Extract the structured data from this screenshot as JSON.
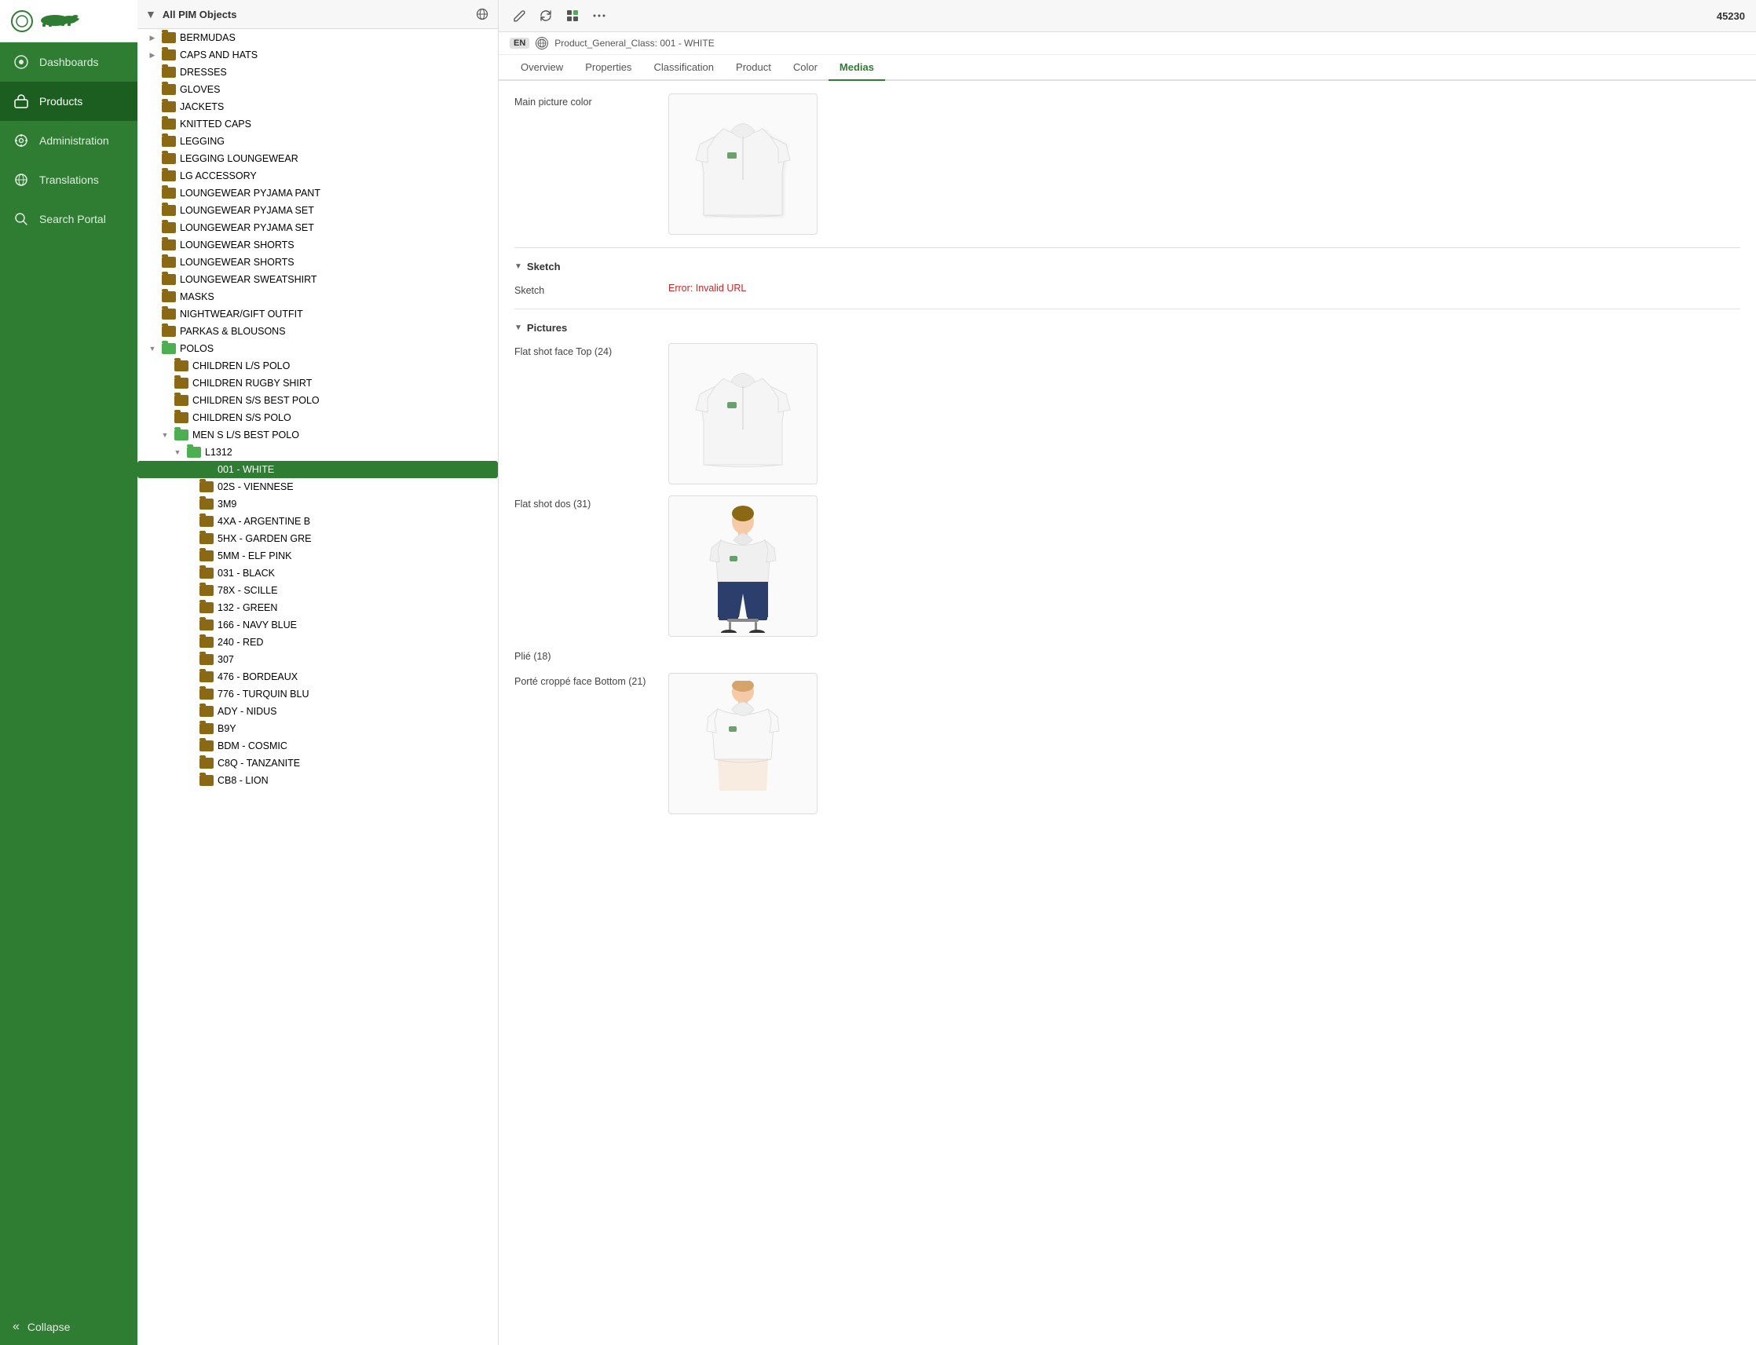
{
  "sidebar": {
    "logo_circle": "○",
    "logo_text": "🐊",
    "items": [
      {
        "id": "dashboards",
        "label": "Dashboards",
        "icon": "⊙",
        "active": false
      },
      {
        "id": "products",
        "label": "Products",
        "icon": "🛒",
        "active": true
      },
      {
        "id": "administration",
        "label": "Administration",
        "icon": "⚙",
        "active": false
      },
      {
        "id": "translations",
        "label": "Translations",
        "icon": "🌐",
        "active": false
      },
      {
        "id": "search-portal",
        "label": "Search Portal",
        "icon": "🔍",
        "active": false
      }
    ],
    "collapse_label": "Collapse",
    "collapse_icon": "«"
  },
  "tree": {
    "toolbar_label": "All PIM Objects",
    "globe_icon": "🌐",
    "items": [
      {
        "id": "bermudas",
        "label": "BERMUDAS",
        "indent": 1,
        "has_children": true,
        "expanded": false,
        "selected": false
      },
      {
        "id": "caps-and-hats",
        "label": "CAPS AND HATS",
        "indent": 1,
        "has_children": true,
        "expanded": false,
        "selected": false
      },
      {
        "id": "dresses",
        "label": "DRESSES",
        "indent": 1,
        "has_children": false,
        "expanded": false,
        "selected": false
      },
      {
        "id": "gloves",
        "label": "GLOVES",
        "indent": 1,
        "has_children": false,
        "expanded": false,
        "selected": false
      },
      {
        "id": "jackets",
        "label": "JACKETS",
        "indent": 1,
        "has_children": false,
        "expanded": false,
        "selected": false
      },
      {
        "id": "knitted-caps",
        "label": "KNITTED CAPS",
        "indent": 1,
        "has_children": false,
        "expanded": false,
        "selected": false
      },
      {
        "id": "legging",
        "label": "LEGGING",
        "indent": 1,
        "has_children": false,
        "expanded": false,
        "selected": false
      },
      {
        "id": "legging-loungewear",
        "label": "LEGGING LOUNGEWEAR",
        "indent": 1,
        "has_children": false,
        "expanded": false,
        "selected": false
      },
      {
        "id": "lg-accessory",
        "label": "LG ACCESSORY",
        "indent": 1,
        "has_children": false,
        "expanded": false,
        "selected": false
      },
      {
        "id": "loungewear-pyjama-pant",
        "label": "LOUNGEWEAR PYJAMA PANT",
        "indent": 1,
        "has_children": false,
        "expanded": false,
        "selected": false
      },
      {
        "id": "loungewear-pyjama-set",
        "label": "LOUNGEWEAR PYJAMA SET",
        "indent": 1,
        "has_children": false,
        "expanded": false,
        "selected": false
      },
      {
        "id": "loungewear-pyjama-set2",
        "label": "LOUNGEWEAR PYJAMA SET",
        "indent": 1,
        "has_children": false,
        "expanded": false,
        "selected": false
      },
      {
        "id": "loungewear-shorts",
        "label": "LOUNGEWEAR SHORTS",
        "indent": 1,
        "has_children": false,
        "expanded": false,
        "selected": false
      },
      {
        "id": "loungewear-shorts2",
        "label": "LOUNGEWEAR SHORTS",
        "indent": 1,
        "has_children": false,
        "expanded": false,
        "selected": false
      },
      {
        "id": "loungewear-sweatshirt",
        "label": "LOUNGEWEAR SWEATSHIRT",
        "indent": 1,
        "has_children": false,
        "expanded": false,
        "selected": false
      },
      {
        "id": "masks",
        "label": "MASKS",
        "indent": 1,
        "has_children": false,
        "expanded": false,
        "selected": false
      },
      {
        "id": "nightwear-gift-outfit",
        "label": "NIGHTWEAR/GIFT OUTFIT",
        "indent": 1,
        "has_children": false,
        "expanded": false,
        "selected": false
      },
      {
        "id": "parkas-blousons",
        "label": "PARKAS & BLOUSONS",
        "indent": 1,
        "has_children": false,
        "expanded": false,
        "selected": false
      },
      {
        "id": "polos",
        "label": "POLOS",
        "indent": 1,
        "has_children": true,
        "expanded": true,
        "selected": false
      },
      {
        "id": "children-ls-polo",
        "label": "CHILDREN L/S POLO",
        "indent": 2,
        "has_children": false,
        "expanded": false,
        "selected": false
      },
      {
        "id": "children-rugby-shirt",
        "label": "CHILDREN RUGBY SHIRT",
        "indent": 2,
        "has_children": false,
        "expanded": false,
        "selected": false
      },
      {
        "id": "children-ss-best-polo",
        "label": "CHILDREN S/S BEST POLO",
        "indent": 2,
        "has_children": false,
        "expanded": false,
        "selected": false
      },
      {
        "id": "children-ss-polo",
        "label": "CHILDREN S/S POLO",
        "indent": 2,
        "has_children": false,
        "expanded": false,
        "selected": false
      },
      {
        "id": "men-s-ls-best-polo",
        "label": "MEN S L/S BEST POLO",
        "indent": 2,
        "has_children": true,
        "expanded": true,
        "selected": false
      },
      {
        "id": "l1312",
        "label": "L1312",
        "indent": 3,
        "has_children": true,
        "expanded": true,
        "selected": false
      },
      {
        "id": "001-white",
        "label": "001 - WHITE",
        "indent": 4,
        "has_children": false,
        "expanded": false,
        "selected": true
      },
      {
        "id": "02s-viennese",
        "label": "02S - VIENNESE",
        "indent": 4,
        "has_children": false,
        "expanded": false,
        "selected": false
      },
      {
        "id": "3m9",
        "label": "3M9",
        "indent": 4,
        "has_children": false,
        "expanded": false,
        "selected": false
      },
      {
        "id": "4xa-argentine",
        "label": "4XA - ARGENTINE B",
        "indent": 4,
        "has_children": false,
        "expanded": false,
        "selected": false
      },
      {
        "id": "5hx-garden-gre",
        "label": "5HX - GARDEN GRE",
        "indent": 4,
        "has_children": false,
        "expanded": false,
        "selected": false
      },
      {
        "id": "5mm-elf-pink",
        "label": "5MM - ELF PINK",
        "indent": 4,
        "has_children": false,
        "expanded": false,
        "selected": false
      },
      {
        "id": "031-black",
        "label": "031 - BLACK",
        "indent": 4,
        "has_children": false,
        "expanded": false,
        "selected": false
      },
      {
        "id": "78x-scille",
        "label": "78X - SCILLE",
        "indent": 4,
        "has_children": false,
        "expanded": false,
        "selected": false
      },
      {
        "id": "132-green",
        "label": "132 - GREEN",
        "indent": 4,
        "has_children": false,
        "expanded": false,
        "selected": false
      },
      {
        "id": "166-navy-blue",
        "label": "166 - NAVY BLUE",
        "indent": 4,
        "has_children": false,
        "expanded": false,
        "selected": false
      },
      {
        "id": "240-red",
        "label": "240 - RED",
        "indent": 4,
        "has_children": false,
        "expanded": false,
        "selected": false
      },
      {
        "id": "307",
        "label": "307",
        "indent": 4,
        "has_children": false,
        "expanded": false,
        "selected": false
      },
      {
        "id": "476-bordeaux",
        "label": "476 - BORDEAUX",
        "indent": 4,
        "has_children": false,
        "expanded": false,
        "selected": false
      },
      {
        "id": "776-turquin-blue",
        "label": "776 - TURQUIN BLU",
        "indent": 4,
        "has_children": false,
        "expanded": false,
        "selected": false
      },
      {
        "id": "ady-nidus",
        "label": "ADY - NIDUS",
        "indent": 4,
        "has_children": false,
        "expanded": false,
        "selected": false
      },
      {
        "id": "b9y",
        "label": "B9Y",
        "indent": 4,
        "has_children": false,
        "expanded": false,
        "selected": false
      },
      {
        "id": "bdm-cosmic",
        "label": "BDM - COSMIC",
        "indent": 4,
        "has_children": false,
        "expanded": false,
        "selected": false
      },
      {
        "id": "c8q-tanzanite",
        "label": "C8Q - TANZANITE",
        "indent": 4,
        "has_children": false,
        "expanded": false,
        "selected": false
      },
      {
        "id": "cb8-lion",
        "label": "CB8 - LION",
        "indent": 4,
        "has_children": false,
        "expanded": false,
        "selected": false
      }
    ]
  },
  "detail": {
    "toolbar_id": "45230",
    "breadcrumb_lang": "EN",
    "breadcrumb_text": "Product_General_Class: 001 - WHITE",
    "tabs": [
      {
        "id": "overview",
        "label": "Overview",
        "active": false
      },
      {
        "id": "properties",
        "label": "Properties",
        "active": false
      },
      {
        "id": "classification",
        "label": "Classification",
        "active": false
      },
      {
        "id": "product",
        "label": "Product",
        "active": false
      },
      {
        "id": "color",
        "label": "Color",
        "active": false
      },
      {
        "id": "medias",
        "label": "Medias",
        "active": true
      }
    ],
    "sections": {
      "main_picture": {
        "label": "Main picture color"
      },
      "sketch": {
        "label": "Sketch",
        "field_label": "Sketch",
        "error": "Error: Invalid URL"
      },
      "pictures": {
        "label": "Pictures",
        "items": [
          {
            "id": "flat-shot-top",
            "label": "Flat shot face Top (24)",
            "count": 24
          },
          {
            "id": "flat-shot-dos",
            "label": "Flat shot dos (31)",
            "count": 31
          },
          {
            "id": "plie",
            "label": "Plié (18)",
            "count": 18
          },
          {
            "id": "porte-croppe",
            "label": "Porté croppé face Bottom (21)",
            "count": 21
          }
        ]
      }
    }
  }
}
